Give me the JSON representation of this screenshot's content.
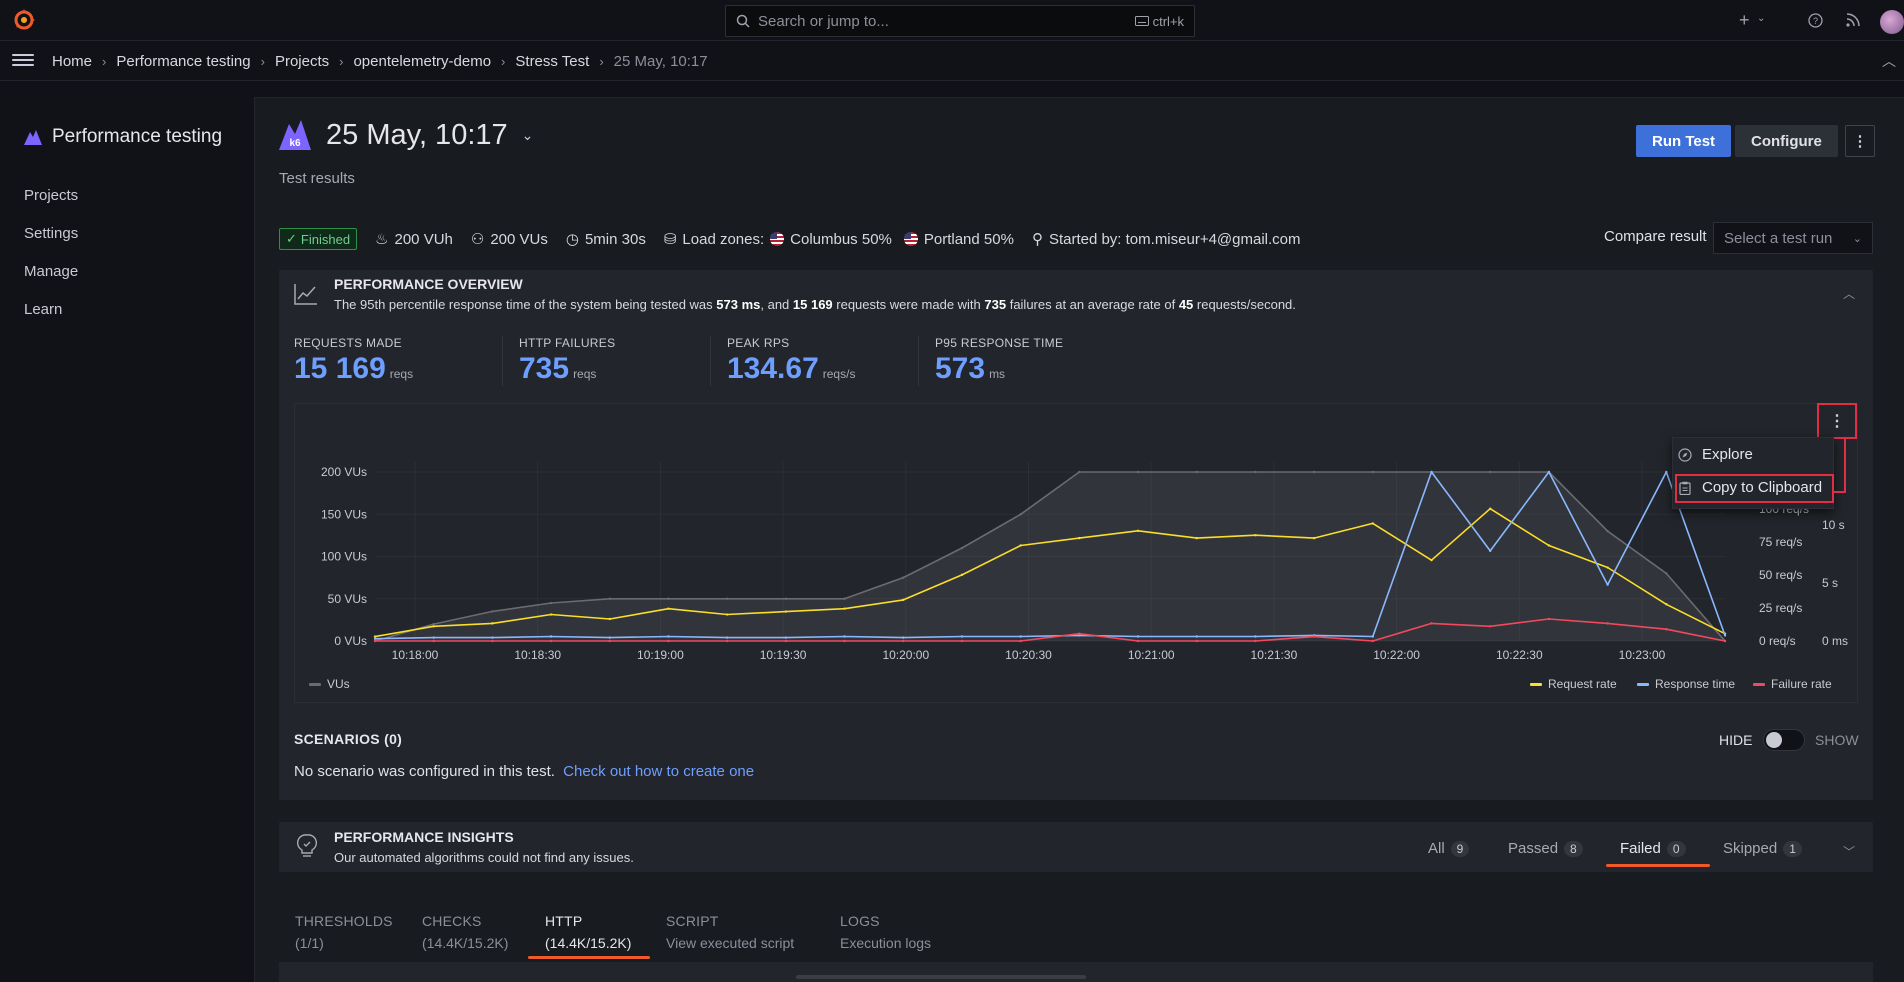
{
  "topbar": {
    "search_placeholder": "Search or jump to...",
    "shortcut": "ctrl+k"
  },
  "breadcrumb": [
    "Home",
    "Performance testing",
    "Projects",
    "opentelemetry-demo",
    "Stress Test",
    "25 May, 10:17"
  ],
  "sidebar": {
    "title": "Performance testing",
    "items": [
      "Projects",
      "Settings",
      "Manage",
      "Learn"
    ]
  },
  "header": {
    "title": "25 May, 10:17",
    "subtitle": "Test results",
    "run_label": "Run Test",
    "configure_label": "Configure"
  },
  "status": {
    "badge": "Finished",
    "vuh": "200 VUh",
    "vus": "200 VUs",
    "duration": "5min 30s",
    "load_zones_label": "Load zones:",
    "zone1": "Columbus 50%",
    "zone2": "Portland 50%",
    "started_by": "Started by: tom.miseur+4@gmail.com",
    "compare_label": "Compare result",
    "compare_placeholder": "Select a test run"
  },
  "overview": {
    "title": "PERFORMANCE OVERVIEW",
    "desc_1": "The 95th percentile response time of the system being tested was ",
    "p95": "573 ms",
    "desc_2": ", and ",
    "requests": "15 169",
    "desc_3": " requests were made with ",
    "failures": "735",
    "desc_4": " failures at an average rate of ",
    "rate": "45",
    "desc_5": " requests/second.",
    "stats": [
      {
        "label": "REQUESTS MADE",
        "value": "15 169",
        "unit": "reqs"
      },
      {
        "label": "HTTP FAILURES",
        "value": "735",
        "unit": "reqs"
      },
      {
        "label": "PEAK RPS",
        "value": "134.67",
        "unit": "reqs/s"
      },
      {
        "label": "P95 RESPONSE TIME",
        "value": "573",
        "unit": "ms"
      }
    ]
  },
  "context_menu": {
    "explore": "Explore",
    "copy": "Copy to Clipboard"
  },
  "legend": {
    "vus": "VUs",
    "request_rate": "Request rate",
    "response_time": "Response time",
    "failure_rate": "Failure rate"
  },
  "colors": {
    "vus": "#6b6b70",
    "request_rate": "#fade2a",
    "response_time": "#8ab8ff",
    "failure_rate": "#f2495c",
    "accent": "#f05a28",
    "primary": "#3d71d9"
  },
  "chart_data": {
    "type": "line",
    "x": [
      "10:17:30",
      "10:17:45",
      "10:18:00",
      "10:18:15",
      "10:18:30",
      "10:18:45",
      "10:19:00",
      "10:19:15",
      "10:19:30",
      "10:19:45",
      "10:20:00",
      "10:20:15",
      "10:20:30",
      "10:20:45",
      "10:21:00",
      "10:21:15",
      "10:21:30",
      "10:21:45",
      "10:22:00",
      "10:22:15",
      "10:22:30",
      "10:22:45",
      "10:23:00",
      "10:23:05"
    ],
    "x_ticks": [
      "10:18:00",
      "10:18:30",
      "10:19:00",
      "10:19:30",
      "10:20:00",
      "10:20:30",
      "10:21:00",
      "10:21:30",
      "10:22:00",
      "10:22:30",
      "10:23:00"
    ],
    "left_axis_ticks": [
      "0 VUs",
      "50 VUs",
      "100 VUs",
      "150 VUs",
      "200 VUs"
    ],
    "right_axis_rps_ticks": [
      "0 req/s",
      "25 req/s",
      "50 req/s",
      "75 req/s",
      "100 req/s"
    ],
    "right_axis_time_ticks": [
      "0 ms",
      "5 s",
      "10 s"
    ],
    "ylim_vus": [
      0,
      200
    ],
    "series": [
      {
        "name": "VUs",
        "values": [
          0,
          20,
          35,
          45,
          50,
          50,
          50,
          50,
          50,
          75,
          110,
          150,
          200,
          200,
          200,
          200,
          200,
          200,
          200,
          200,
          200,
          130,
          80,
          0
        ]
      },
      {
        "name": "Request rate",
        "values": [
          3,
          10,
          12,
          18,
          15,
          22,
          18,
          20,
          22,
          28,
          45,
          65,
          70,
          75,
          70,
          72,
          70,
          80,
          55,
          90,
          65,
          50,
          25,
          5
        ]
      },
      {
        "name": "Response time",
        "values": [
          0.2,
          0.3,
          0.3,
          0.4,
          0.3,
          0.4,
          0.3,
          0.3,
          0.4,
          0.3,
          0.4,
          0.4,
          0.5,
          0.4,
          0.4,
          0.4,
          0.5,
          0.4,
          15,
          8,
          15,
          5,
          15,
          0.5
        ]
      },
      {
        "name": "Failure rate",
        "values": [
          0,
          0,
          0,
          0,
          0,
          0,
          0,
          0,
          0,
          0,
          0,
          0,
          5,
          0,
          0,
          0,
          3,
          0,
          12,
          10,
          15,
          12,
          8,
          0
        ]
      }
    ]
  },
  "scenarios": {
    "title": "SCENARIOS (0)",
    "text": "No scenario was configured in this test.",
    "link": "Check out how to create one",
    "hide": "HIDE",
    "show": "SHOW"
  },
  "insights": {
    "title": "PERFORMANCE INSIGHTS",
    "desc": "Our automated algorithms could not find any issues.",
    "tabs": [
      {
        "label": "All",
        "count": "9"
      },
      {
        "label": "Passed",
        "count": "8"
      },
      {
        "label": "Failed",
        "count": "0"
      },
      {
        "label": "Skipped",
        "count": "1"
      }
    ]
  },
  "result_tabs": [
    {
      "label": "THRESHOLDS",
      "sub": "(1/1)"
    },
    {
      "label": "CHECKS",
      "sub": "(14.4K/15.2K)"
    },
    {
      "label": "HTTP",
      "sub": "(14.4K/15.2K)"
    },
    {
      "label": "SCRIPT",
      "sub": "View executed script"
    },
    {
      "label": "LOGS",
      "sub": "Execution logs"
    }
  ]
}
